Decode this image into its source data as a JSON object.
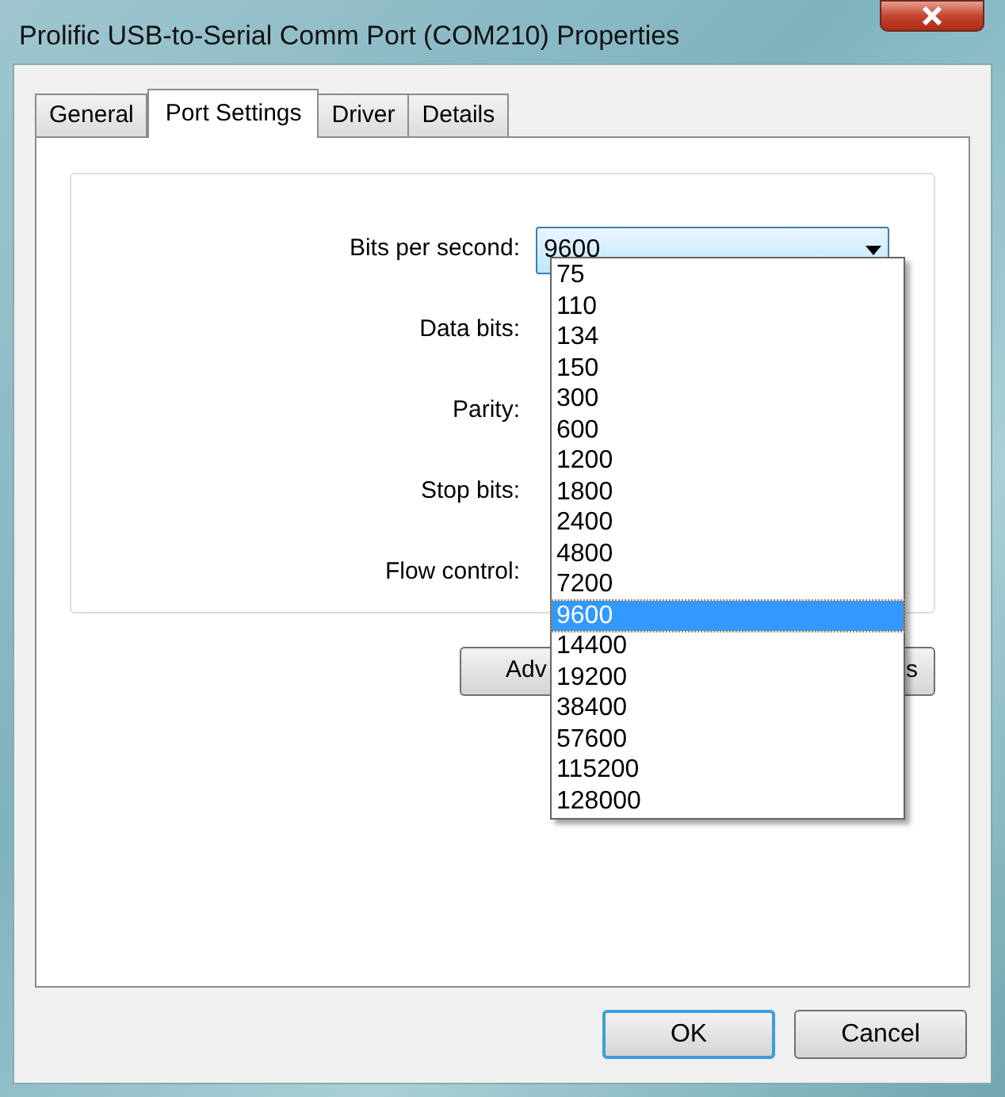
{
  "window": {
    "title": "Prolific USB-to-Serial Comm Port (COM210) Properties"
  },
  "tabs": [
    {
      "label": "General",
      "selected": false
    },
    {
      "label": "Port Settings",
      "selected": true
    },
    {
      "label": "Driver",
      "selected": false
    },
    {
      "label": "Details",
      "selected": false
    }
  ],
  "fields": [
    {
      "label": "Bits per second:",
      "value": "9600"
    },
    {
      "label": "Data bits:"
    },
    {
      "label": "Parity:"
    },
    {
      "label": "Stop bits:"
    },
    {
      "label": "Flow control:"
    }
  ],
  "dropdown": {
    "options": [
      {
        "label": "75",
        "selected": false
      },
      {
        "label": "110",
        "selected": false
      },
      {
        "label": "134",
        "selected": false
      },
      {
        "label": "150",
        "selected": false
      },
      {
        "label": "300",
        "selected": false
      },
      {
        "label": "600",
        "selected": false
      },
      {
        "label": "1200",
        "selected": false
      },
      {
        "label": "1800",
        "selected": false
      },
      {
        "label": "2400",
        "selected": false
      },
      {
        "label": "4800",
        "selected": false
      },
      {
        "label": "7200",
        "selected": false
      },
      {
        "label": "9600",
        "selected": true
      },
      {
        "label": "14400",
        "selected": false
      },
      {
        "label": "19200",
        "selected": false
      },
      {
        "label": "38400",
        "selected": false
      },
      {
        "label": "57600",
        "selected": false
      },
      {
        "label": "115200",
        "selected": false
      },
      {
        "label": "128000",
        "selected": false
      }
    ]
  },
  "panel_buttons": [
    "Adv",
    "s"
  ],
  "buttons": [
    {
      "label": "OK",
      "default": true
    },
    {
      "label": "Cancel",
      "default": false
    }
  ]
}
